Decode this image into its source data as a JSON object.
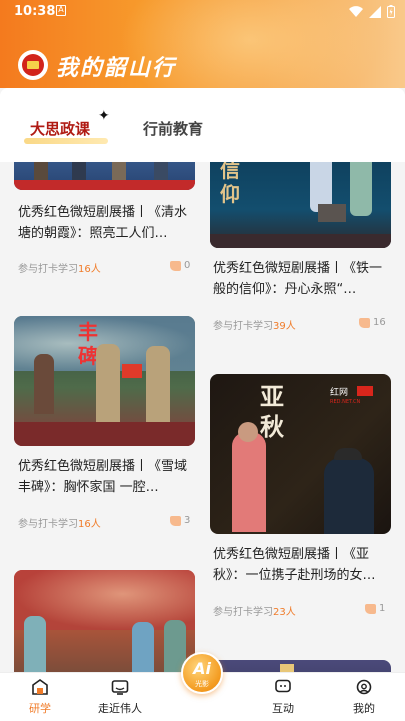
{
  "status_bar": {
    "time": "10:38",
    "sim_label": "A"
  },
  "header": {
    "brand": "我的韶山行"
  },
  "tabs": [
    {
      "label": "大思政课",
      "active": true
    },
    {
      "label": "行前教育",
      "active": false
    }
  ],
  "feed": {
    "left": [
      {
        "title": "优秀红色微短剧展播丨《清水塘的朝霞》：照亮工人们…",
        "meta_prefix": "参与打卡学习",
        "count": "16人",
        "likes": "0"
      },
      {
        "title": "优秀红色微短剧展播丨《雪域丰碑》：胸怀家国 一腔…",
        "meta_prefix": "参与打卡学习",
        "count": "16人",
        "likes": "3",
        "image_text": "丰碑"
      },
      {
        "title": "",
        "meta_prefix": "",
        "count": "",
        "likes": ""
      }
    ],
    "right": [
      {
        "title": "优秀红色微短剧展播丨《铁一般的信仰》：丹心永照“…",
        "meta_prefix": "参与打卡学习",
        "count": "39人",
        "likes": "16",
        "image_text": "信仰"
      },
      {
        "title": "优秀红色微短剧展播丨《亚秋》：一位携子赴刑场的女…",
        "meta_prefix": "参与打卡学习",
        "count": "23人",
        "likes": "1",
        "image_text": "亚秋",
        "image_logo": "红网",
        "image_logo_sub": "RED.NET.CN"
      }
    ]
  },
  "bottom_nav": [
    {
      "label": "研学",
      "icon": "home-icon",
      "active": true
    },
    {
      "label": "走近伟人",
      "icon": "tv-icon",
      "active": false
    },
    {
      "label": "互动",
      "icon": "chat-icon",
      "active": false
    },
    {
      "label": "我的",
      "icon": "profile-icon",
      "active": false
    }
  ],
  "ai_button": {
    "label": "Ai",
    "sub": "光影"
  },
  "colors": {
    "accent": "#f07c2a",
    "header_start": "#f47a1e",
    "active_tab": "#b01b14"
  }
}
